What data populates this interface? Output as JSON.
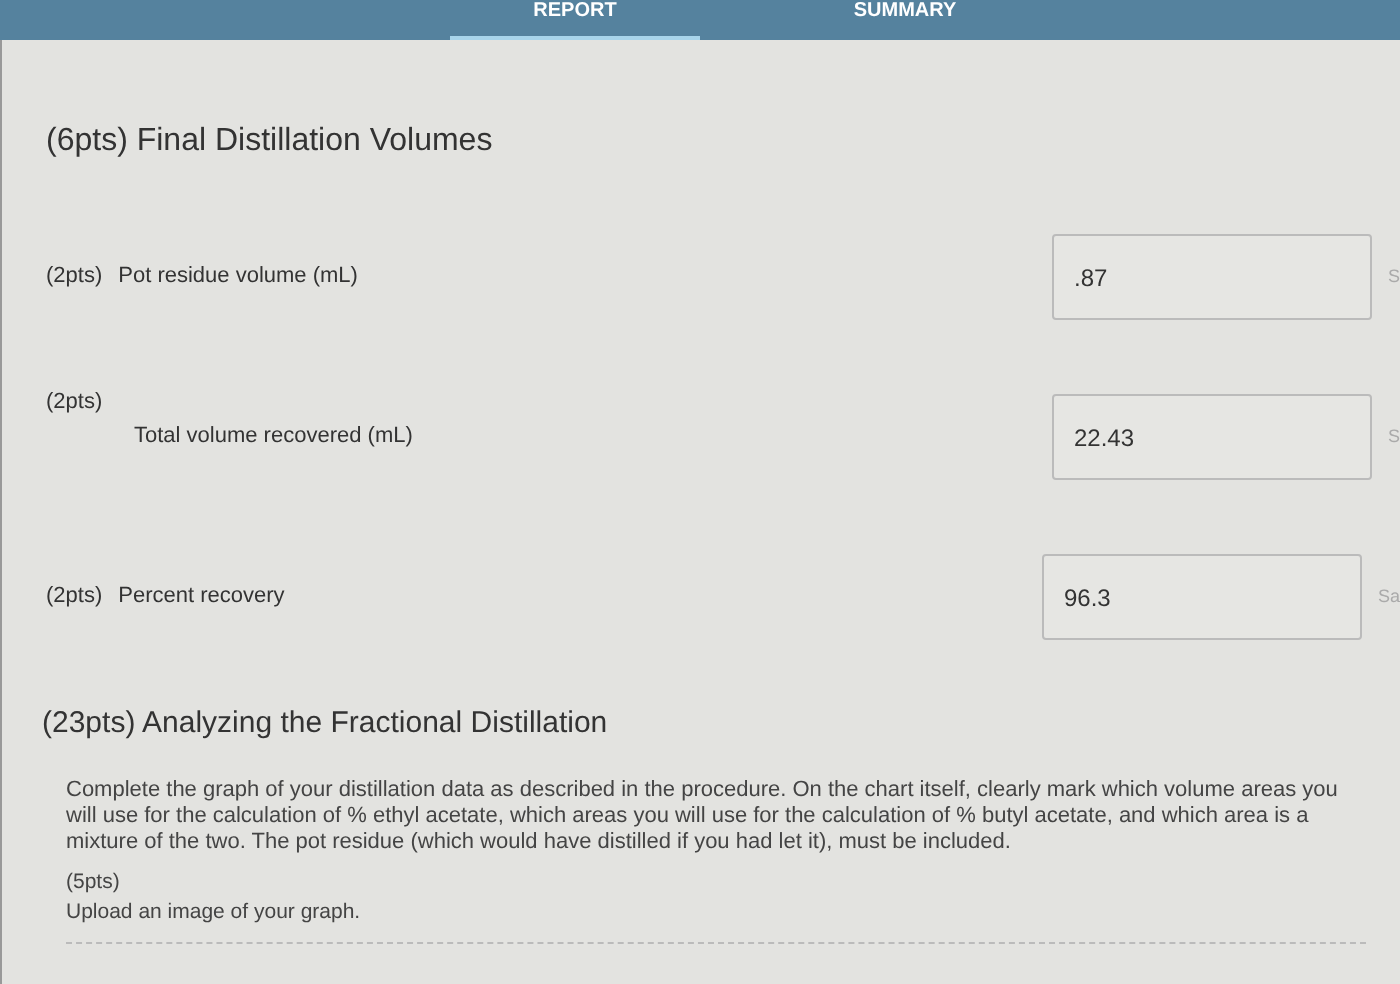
{
  "tabs": [
    {
      "label": "REPORT",
      "selected": true
    },
    {
      "label": "SUMMARY",
      "selected": false
    }
  ],
  "section_1": {
    "title": "(6pts) Final Distillation Volumes",
    "fields": [
      {
        "points": "(2pts)",
        "label": "Pot residue volume (mL)",
        "value": ".87",
        "side_text": "S",
        "kind": "inline"
      },
      {
        "points": "(2pts)",
        "label": "Total volume recovered (mL)",
        "value": "22.43",
        "side_text": "S",
        "kind": "stacked"
      },
      {
        "points": "(2pts)",
        "label": "Percent recovery",
        "value": "96.3",
        "side_text": "Sa",
        "kind": "inline"
      }
    ]
  },
  "section_2": {
    "title": "(23pts) Analyzing the Fractional Distillation",
    "instructions": "Complete the graph of your distillation data as described in the procedure. On the chart itself, clearly mark which volume areas you will use for the calculation of % ethyl acetate, which areas you will use for the calculation of % butyl acetate, and which area is a mixture of the two. The pot residue (which would have distilled if you had let it), must be included.",
    "upload_points": "(5pts)",
    "upload_label": "Upload an image of your graph."
  }
}
